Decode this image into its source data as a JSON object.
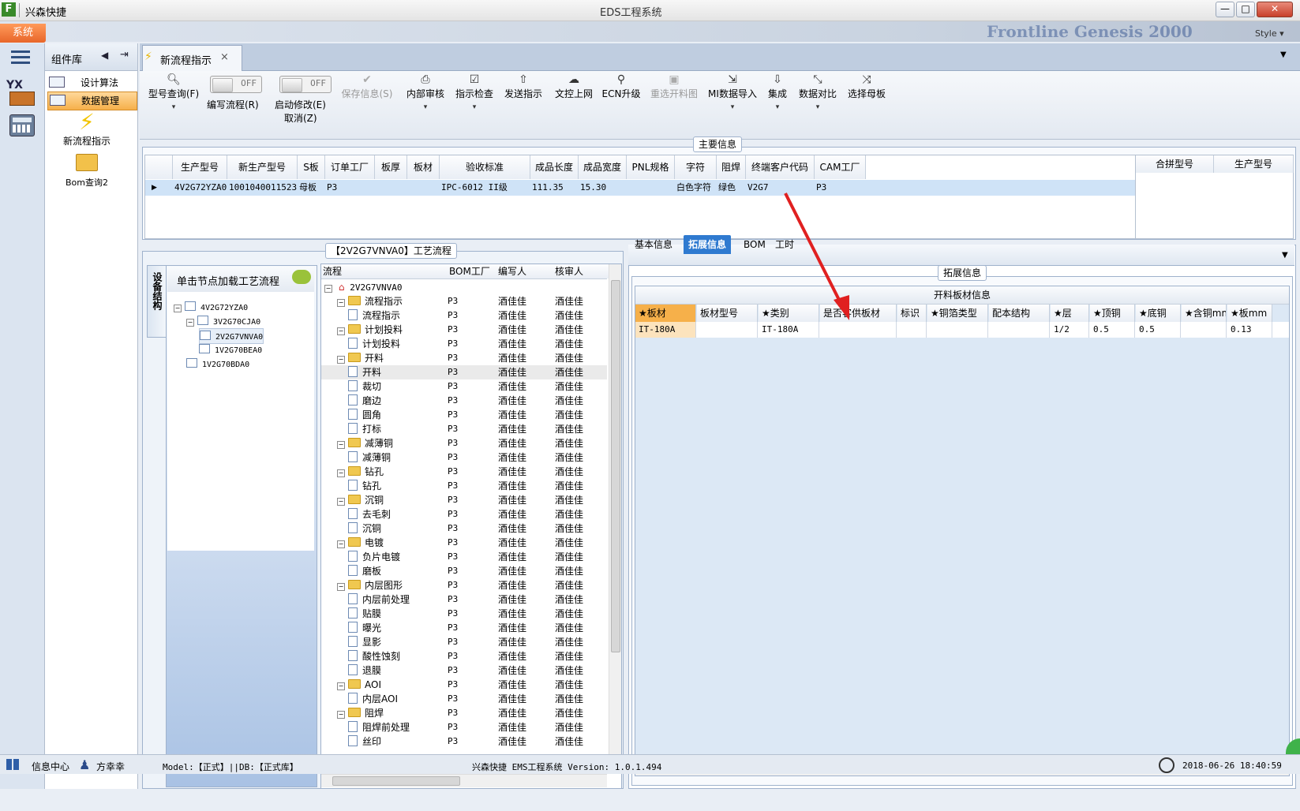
{
  "window": {
    "app_name": "兴森快捷",
    "title": "EDS工程系统",
    "style_label": "Style",
    "brand_overlay": "Frontline  Genesis 2000",
    "minimize": "—",
    "maximize": "□",
    "close": "✕"
  },
  "menu": {
    "system_button": "系统"
  },
  "rail": {
    "icons": [
      "hamburger-icon",
      "factory-yx-icon",
      "calculator-icon"
    ],
    "yx_text": "YX"
  },
  "library": {
    "title": "组件库",
    "items": [
      {
        "label": "设计算法",
        "selected": false
      },
      {
        "label": "数据管理",
        "selected": true
      }
    ],
    "tiles": [
      {
        "label": "新流程指示",
        "icon": "lightning-icon"
      },
      {
        "label": "Bom查询2",
        "icon": "folder-open-icon"
      }
    ]
  },
  "doc_tab": {
    "label": "新流程指示",
    "close": "×"
  },
  "toolbar": {
    "model_query": "型号查询(F)",
    "toggle1_state": "OFF",
    "edit_flow": "编写流程(R)",
    "toggle2_state": "OFF",
    "start_modify": "启动修改(E)",
    "cancel": "取消(Z)",
    "save_info": "保存信息(S)",
    "internal_review": "内部审核",
    "instruction_check": "指示检查",
    "send_instruction": "发送指示",
    "doc_upload": "文控上网",
    "ecn_upgrade": "ECN升级",
    "reselect_cutting": "重选开料图",
    "mi_import": "MI数据导入",
    "integrate": "集成",
    "data_compare": "数据对比",
    "choose_mother": "选择母板"
  },
  "main_info": {
    "title": "主要信息",
    "columns": [
      "生产型号",
      "新生产型号",
      "S板",
      "订单工厂",
      "板厚",
      "板材",
      "验收标准",
      "成品长度",
      "成品宽度",
      "PNL规格",
      "字符",
      "阻焊",
      "终端客户代码",
      "CAM工厂"
    ],
    "row": [
      "4V2G72YZA0",
      "10010400115235",
      "母板",
      "P3",
      "",
      "",
      "IPC-6012 II级",
      "111.35",
      "15.30",
      "",
      "白色字符",
      "绿色",
      "V2G7",
      "P3"
    ],
    "side_columns": [
      "合拼型号",
      "生产型号"
    ]
  },
  "process": {
    "title": "【2V2G7VNVA0】工艺流程",
    "vertical_tab": "设备结构",
    "hint": "单击节点加载工艺流程",
    "tree": [
      {
        "label": "4V2G72YZA0",
        "level": 0
      },
      {
        "label": "3V2G70CJA0",
        "level": 1
      },
      {
        "label": "2V2G7VNVA0",
        "level": 2,
        "selected": true
      },
      {
        "label": "1V2G70BEA0",
        "level": 2
      },
      {
        "label": "1V2G70BDA0",
        "level": 1
      }
    ],
    "grid_columns": [
      "流程",
      "BOM工厂",
      "编写人",
      "核审人"
    ],
    "root": "2V2G7VNVA0",
    "rows": [
      {
        "name": "流程指示",
        "type": "folder",
        "factory": "P3",
        "writer": "酒佳佳",
        "reviewer": "酒佳佳"
      },
      {
        "name": "流程指示",
        "type": "doc",
        "factory": "P3",
        "writer": "酒佳佳",
        "reviewer": "酒佳佳"
      },
      {
        "name": "计划投料",
        "type": "folder",
        "factory": "P3",
        "writer": "酒佳佳",
        "reviewer": "酒佳佳"
      },
      {
        "name": "计划投料",
        "type": "doc",
        "factory": "P3",
        "writer": "酒佳佳",
        "reviewer": "酒佳佳"
      },
      {
        "name": "开料",
        "type": "folder",
        "factory": "P3",
        "writer": "酒佳佳",
        "reviewer": "酒佳佳"
      },
      {
        "name": "开料",
        "type": "doc",
        "factory": "P3",
        "writer": "酒佳佳",
        "reviewer": "酒佳佳",
        "selected": true
      },
      {
        "name": "裁切",
        "type": "doc",
        "factory": "P3",
        "writer": "酒佳佳",
        "reviewer": "酒佳佳"
      },
      {
        "name": "磨边",
        "type": "doc",
        "factory": "P3",
        "writer": "酒佳佳",
        "reviewer": "酒佳佳"
      },
      {
        "name": "圆角",
        "type": "doc",
        "factory": "P3",
        "writer": "酒佳佳",
        "reviewer": "酒佳佳"
      },
      {
        "name": "打标",
        "type": "doc",
        "factory": "P3",
        "writer": "酒佳佳",
        "reviewer": "酒佳佳"
      },
      {
        "name": "减薄铜",
        "type": "folder",
        "factory": "P3",
        "writer": "酒佳佳",
        "reviewer": "酒佳佳"
      },
      {
        "name": "减薄铜",
        "type": "doc",
        "factory": "P3",
        "writer": "酒佳佳",
        "reviewer": "酒佳佳"
      },
      {
        "name": "钻孔",
        "type": "folder",
        "factory": "P3",
        "writer": "酒佳佳",
        "reviewer": "酒佳佳"
      },
      {
        "name": "钻孔",
        "type": "doc",
        "factory": "P3",
        "writer": "酒佳佳",
        "reviewer": "酒佳佳"
      },
      {
        "name": "沉铜",
        "type": "folder",
        "factory": "P3",
        "writer": "酒佳佳",
        "reviewer": "酒佳佳"
      },
      {
        "name": "去毛刺",
        "type": "doc",
        "factory": "P3",
        "writer": "酒佳佳",
        "reviewer": "酒佳佳"
      },
      {
        "name": "沉铜",
        "type": "doc",
        "factory": "P3",
        "writer": "酒佳佳",
        "reviewer": "酒佳佳"
      },
      {
        "name": "电镀",
        "type": "folder",
        "factory": "P3",
        "writer": "酒佳佳",
        "reviewer": "酒佳佳"
      },
      {
        "name": "负片电镀",
        "type": "doc",
        "factory": "P3",
        "writer": "酒佳佳",
        "reviewer": "酒佳佳"
      },
      {
        "name": "磨板",
        "type": "doc",
        "factory": "P3",
        "writer": "酒佳佳",
        "reviewer": "酒佳佳"
      },
      {
        "name": "内层图形",
        "type": "folder",
        "factory": "P3",
        "writer": "酒佳佳",
        "reviewer": "酒佳佳"
      },
      {
        "name": "内层前处理",
        "type": "doc",
        "factory": "P3",
        "writer": "酒佳佳",
        "reviewer": "酒佳佳"
      },
      {
        "name": "贴膜",
        "type": "doc",
        "factory": "P3",
        "writer": "酒佳佳",
        "reviewer": "酒佳佳"
      },
      {
        "name": "曝光",
        "type": "doc",
        "factory": "P3",
        "writer": "酒佳佳",
        "reviewer": "酒佳佳"
      },
      {
        "name": "显影",
        "type": "doc",
        "factory": "P3",
        "writer": "酒佳佳",
        "reviewer": "酒佳佳"
      },
      {
        "name": "酸性蚀刻",
        "type": "doc",
        "factory": "P3",
        "writer": "酒佳佳",
        "reviewer": "酒佳佳"
      },
      {
        "name": "退膜",
        "type": "doc",
        "factory": "P3",
        "writer": "酒佳佳",
        "reviewer": "酒佳佳"
      },
      {
        "name": "AOI",
        "type": "folder",
        "factory": "P3",
        "writer": "酒佳佳",
        "reviewer": "酒佳佳"
      },
      {
        "name": "内层AOI",
        "type": "doc",
        "factory": "P3",
        "writer": "酒佳佳",
        "reviewer": "酒佳佳"
      },
      {
        "name": "阻焊",
        "type": "folder",
        "factory": "P3",
        "writer": "酒佳佳",
        "reviewer": "酒佳佳"
      },
      {
        "name": "阻焊前处理",
        "type": "doc",
        "factory": "P3",
        "writer": "酒佳佳",
        "reviewer": "酒佳佳"
      },
      {
        "name": "丝印",
        "type": "doc",
        "factory": "P3",
        "writer": "酒佳佳",
        "reviewer": "酒佳佳"
      }
    ]
  },
  "detail": {
    "tabs": [
      {
        "label": "基本信息",
        "active": false
      },
      {
        "label": "拓展信息",
        "active": true
      },
      {
        "label": "BOM",
        "active": false
      },
      {
        "label": "工时",
        "active": false
      }
    ],
    "group_title": "拓展信息",
    "table_title": "开料板材信息",
    "columns": [
      "★板材",
      "板材型号",
      "★类别",
      "是否客供板材",
      "标识",
      "★铜箔类型",
      "配本结构",
      "★层",
      "★顶铜",
      "★底铜",
      "★含铜mm",
      "★板mm"
    ],
    "row": [
      "IT-180A",
      "",
      "IT-180A",
      "",
      "",
      "",
      "",
      "1/2",
      "0.5",
      "0.5",
      "",
      "0.13"
    ]
  },
  "statusbar": {
    "info_center": "信息中心",
    "user": "方幸幸",
    "model_db": "Model:【正式】||DB:【正式库】",
    "version": "兴森快捷 EMS工程系统 Version: 1.0.1.494",
    "datetime": "2018-06-26 18:40:59"
  },
  "colors": {
    "accent_orange": "#f0a04a",
    "selection_blue": "#cfe3f7",
    "tab_active_blue": "#2f7ad0",
    "arrow_red": "#e02020"
  }
}
